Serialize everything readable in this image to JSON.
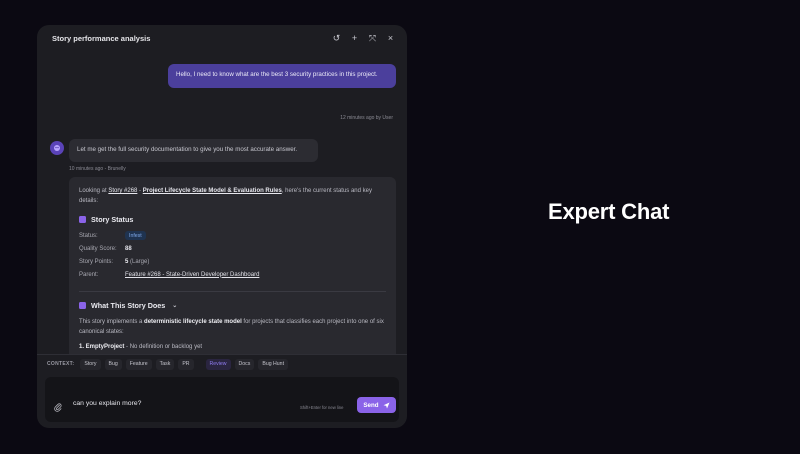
{
  "panel": {
    "title": "Story performance analysis",
    "tools": [
      {
        "icon": "history-icon",
        "glyph": "↺"
      },
      {
        "icon": "plus-icon",
        "glyph": "+"
      },
      {
        "icon": "expand-icon",
        "glyph": "⤧"
      },
      {
        "icon": "close-icon",
        "glyph": "×"
      }
    ]
  },
  "messages": {
    "user": {
      "text": "Hello, I need to know what are the best 3 security practices in this project.",
      "meta": "12 minutes ago by User"
    },
    "bot": {
      "text": "Let me get the full security documentation to give you the most accurate answer.",
      "meta": "10 minutes ago - Brunelly"
    }
  },
  "answer": {
    "intro_prefix": "Looking at ",
    "intro_story": "Story #268",
    "intro_dash": " - ",
    "intro_title": "Project Lifecycle State Model & Evaluation Rules",
    "intro_suffix": ", here's the current status and key details:",
    "status_heading": "Story Status",
    "status_label": "Status:",
    "status_value": "Infest",
    "quality_label": "Quality Score:",
    "quality_value": "88",
    "points_label": "Story Points:",
    "points_value": "5",
    "points_suffix": " (Large)",
    "parent_label": "Parent:",
    "parent_value": "Feature #268 - State-Driven Developer Dashboard",
    "what_heading": "What This Story Does",
    "desc_prefix": "This story implements a ",
    "desc_bold": "deterministic lifecycle state model",
    "desc_suffix": " for projects that classifies each project into one of six canonical states:",
    "item1_bold": "1. EmptyProject",
    "item1_rest": " - No definition or backlog yet"
  },
  "context": {
    "label": "CONTEXT:",
    "chips": [
      "Story",
      "Bug",
      "Feature",
      "Task",
      "PR",
      "Review",
      "Docs",
      "Bug Hunt"
    ],
    "active": "Review"
  },
  "composer": {
    "value": "can you explain more?",
    "hint": "Shift+Enter for new line",
    "send_label": "Send"
  },
  "side": {
    "heading": "Expert Chat"
  },
  "colors": {
    "accent": "#8a63e8",
    "user_bubble": "#4b3f9c",
    "panel_bg": "#1d1d22",
    "page_bg": "#0b0912",
    "score": "#4cc487"
  }
}
